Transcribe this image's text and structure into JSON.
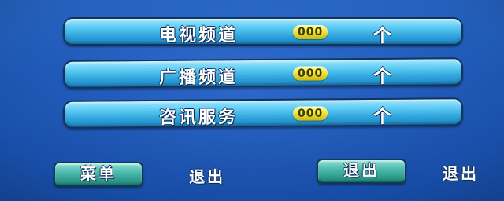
{
  "menu": {
    "items": [
      {
        "label": "电视频道",
        "count": "000",
        "unit": "个"
      },
      {
        "label": "广播频道",
        "count": "000",
        "unit": "个"
      },
      {
        "label": "咨讯服务",
        "count": "000",
        "unit": "个"
      }
    ]
  },
  "footer": {
    "menu_button_label": "菜单",
    "menu_action_label": "退出",
    "exit_button_label": "退出",
    "exit_action_label": "退出"
  },
  "colors": {
    "background": "#1f5fc8",
    "bar": "#2ea3da",
    "badge": "#f3e63a",
    "button": "#47b7a9"
  }
}
